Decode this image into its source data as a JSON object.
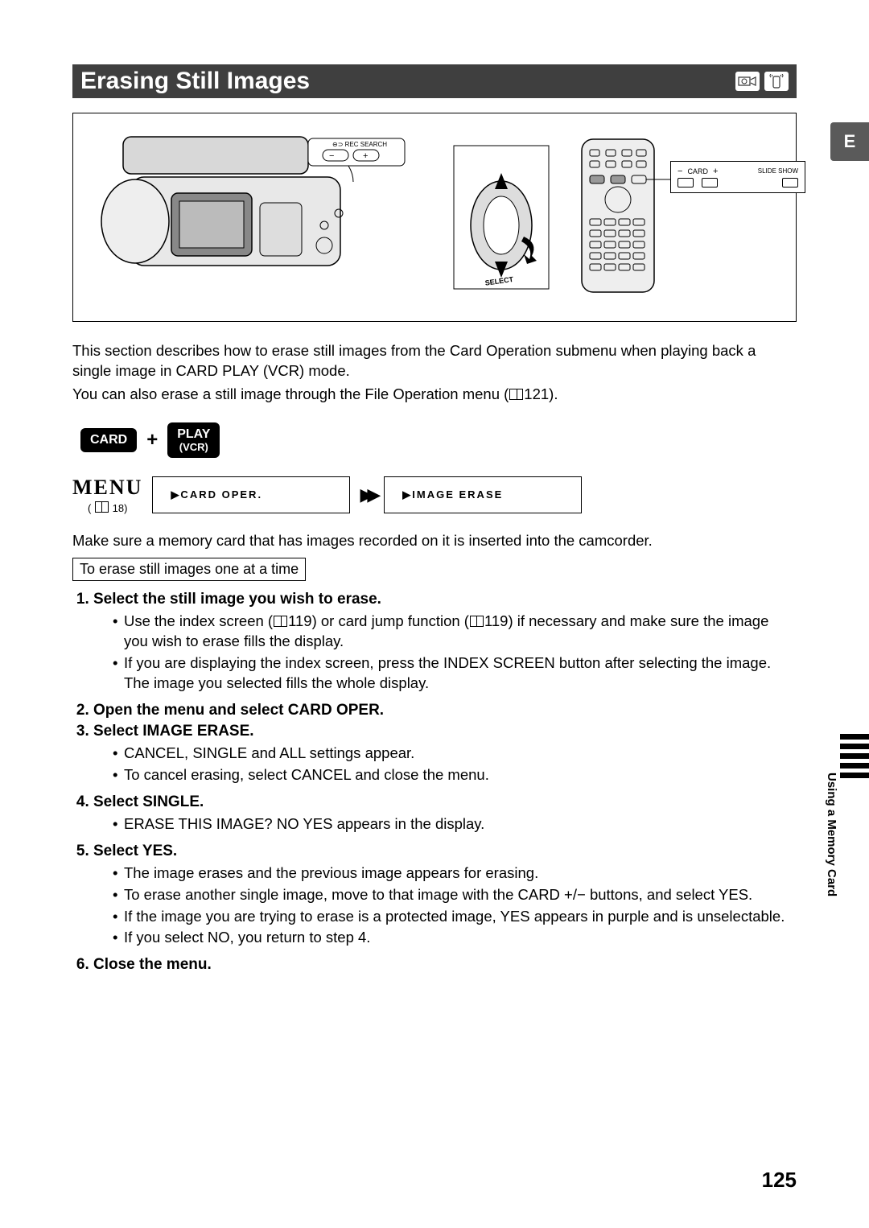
{
  "langTab": "E",
  "title": "Erasing Still Images",
  "illustration": {
    "recSearchLabel": "REC SEARCH",
    "selectLabel": "SELECT",
    "remoteCallout": {
      "cardMinus": "−",
      "cardLabel": "CARD",
      "cardPlus": "+",
      "slideShow": "SLIDE SHOW"
    }
  },
  "intro": {
    "p1a": "This section describes how to erase still images from the Card Operation submenu when playing back a single image in CARD PLAY (VCR) mode.",
    "p2a": "You can also erase a still image through the File Operation menu (",
    "p2ref": "121",
    "p2b": ")."
  },
  "modeBadges": {
    "card": "CARD",
    "play": "PLAY",
    "vcr": "(VCR)"
  },
  "menuNav": {
    "menuLabel": "MENU",
    "menuRef": "18)",
    "box1": "▶CARD OPER.",
    "box2": "▶IMAGE ERASE"
  },
  "preStep": "Make sure a memory card that has images recorded on it is inserted into the camcorder.",
  "subHeader": "To erase still images one at a time",
  "steps": [
    {
      "title": "Select the still image you wish to erase.",
      "subs": [
        {
          "a": "Use the index screen (",
          "ref": "119",
          "b": ") or card jump function (",
          "ref2": "119",
          "c": ") if necessary and make sure the image you wish to erase fills the display."
        },
        {
          "a": "If you are displaying the index screen, press the INDEX SCREEN button after selecting the image. The image you selected fills the whole display."
        }
      ]
    },
    {
      "title": "Open the menu and select CARD OPER."
    },
    {
      "title": "Select IMAGE ERASE.",
      "subs": [
        {
          "a": "CANCEL, SINGLE and ALL settings appear."
        },
        {
          "a": "To cancel erasing, select CANCEL and close the menu."
        }
      ]
    },
    {
      "title": "Select SINGLE.",
      "subs": [
        {
          "a": "ERASE THIS IMAGE? NO YES appears in the display."
        }
      ]
    },
    {
      "title": "Select YES.",
      "subs": [
        {
          "a": "The image erases and the previous image appears for erasing."
        },
        {
          "a": "To erase another single image, move to that image with the CARD +/− buttons, and select YES."
        },
        {
          "a": "If the image you are trying to erase is a protected image, YES appears in purple and is unselectable."
        },
        {
          "a": "If you select NO, you return to step 4."
        }
      ]
    },
    {
      "title": "Close the menu."
    }
  ],
  "sideLabel": "Using a Memory Card",
  "pageNumber": "125"
}
